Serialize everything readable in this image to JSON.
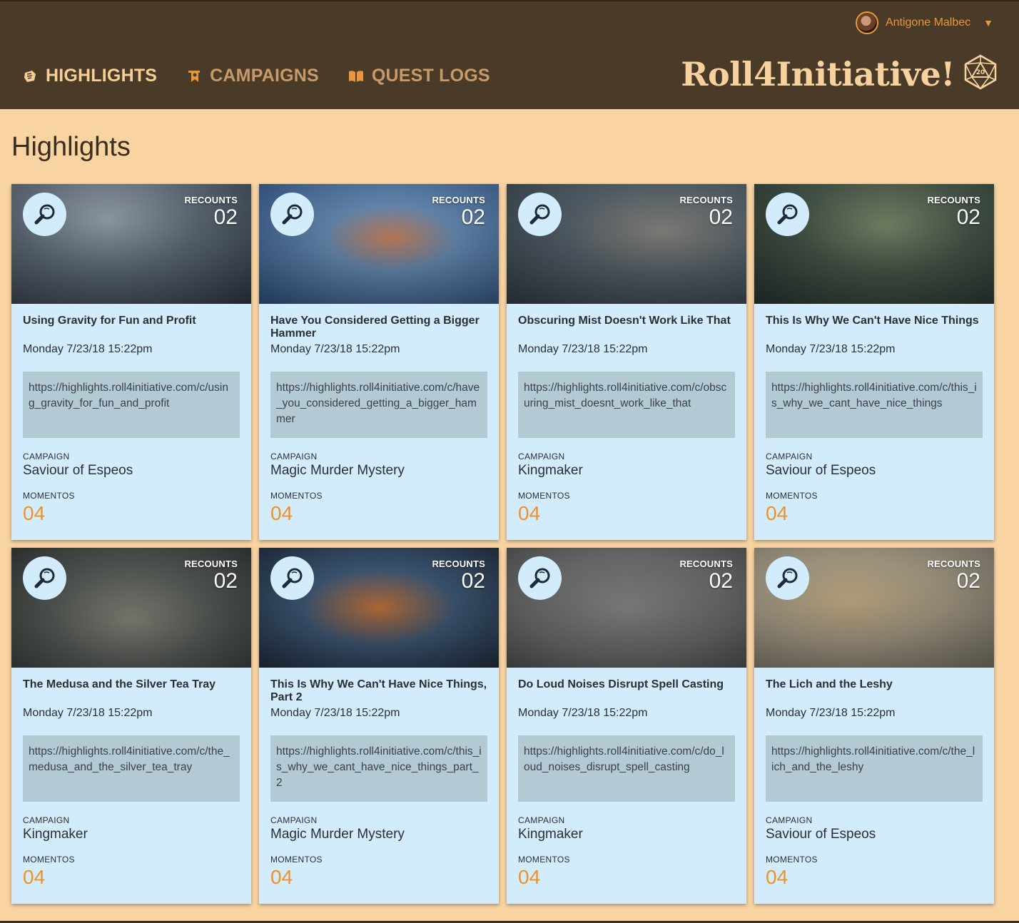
{
  "header": {
    "user_name": "Antigone Malbec",
    "brand": "Roll4Initiative!",
    "nav": [
      {
        "label": "HIGHLIGHTS",
        "icon": "highlight-icon",
        "active": true
      },
      {
        "label": "CAMPAIGNS",
        "icon": "campaign-banner-icon",
        "active": false
      },
      {
        "label": "QUEST LOGS",
        "icon": "book-icon",
        "active": false
      }
    ]
  },
  "page": {
    "title": "Highlights"
  },
  "labels": {
    "recounts": "RECOUNTS",
    "campaign": "CAMPAIGN",
    "momentos": "MOMENTOS"
  },
  "colors": {
    "header_bg": "#4a3a28",
    "page_bg": "#f9d4a2",
    "card_bg": "#d3ecfb",
    "accent": "#ef9226",
    "url_bg": "#b3c9d4"
  },
  "cards": [
    {
      "title": "Using Gravity for Fun and Profit",
      "date": "Monday 7/23/18 15:22pm",
      "url": "https://highlights.roll4initiative.com/c/using_gravity_for_fun_and_profit",
      "campaign": "Saviour of Espeos",
      "momentos": "04",
      "recounts": "02",
      "image": "floating-city-art"
    },
    {
      "title": "Have You Considered Getting a Bigger Hammer",
      "date": "Monday 7/23/18 15:22pm",
      "url": "https://highlights.roll4initiative.com/c/have_you_considered_getting_a_bigger_hammer",
      "campaign": "Magic Murder Mystery",
      "momentos": "04",
      "recounts": "02",
      "image": "dwarf-hammer-art"
    },
    {
      "title": "Obscuring Mist Doesn't Work Like That",
      "date": "Monday 7/23/18 15:22pm",
      "url": "https://highlights.roll4initiative.com/c/obscuring_mist_doesnt_work_like_that",
      "campaign": "Kingmaker",
      "momentos": "04",
      "recounts": "02",
      "image": "panther-knight-art"
    },
    {
      "title": "This Is Why We Can't Have Nice Things",
      "date": "Monday 7/23/18 15:22pm",
      "url": "https://highlights.roll4initiative.com/c/this_is_why_we_cant_have_nice_things",
      "campaign": "Saviour of Espeos",
      "momentos": "04",
      "recounts": "02",
      "image": "forest-creature-art"
    },
    {
      "title": "The Medusa and the Silver Tea Tray",
      "date": "Monday 7/23/18 15:22pm",
      "url": "https://highlights.roll4initiative.com/c/the_medusa_and_the_silver_tea_tray",
      "campaign": "Kingmaker",
      "momentos": "04",
      "recounts": "02",
      "image": "medusa-art"
    },
    {
      "title": "This Is Why We Can't Have Nice Things, Part 2",
      "date": "Monday 7/23/18 15:22pm",
      "url": "https://highlights.roll4initiative.com/c/this_is_why_we_cant_have_nice_things_part_2",
      "campaign": "Magic Murder Mystery",
      "momentos": "04",
      "recounts": "02",
      "image": "goggles-wizard-art"
    },
    {
      "title": "Do Loud Noises Disrupt Spell Casting",
      "date": "Monday 7/23/18 15:22pm",
      "url": "https://highlights.roll4initiative.com/c/do_loud_noises_disrupt_spell_casting",
      "campaign": "Kingmaker",
      "momentos": "04",
      "recounts": "02",
      "image": "bard-drum-art"
    },
    {
      "title": "The Lich and the Leshy",
      "date": "Monday 7/23/18 15:22pm",
      "url": "https://highlights.roll4initiative.com/c/the_lich_and_the_leshy",
      "campaign": "Saviour of Espeos",
      "momentos": "04",
      "recounts": "02",
      "image": "leshy-art"
    }
  ]
}
